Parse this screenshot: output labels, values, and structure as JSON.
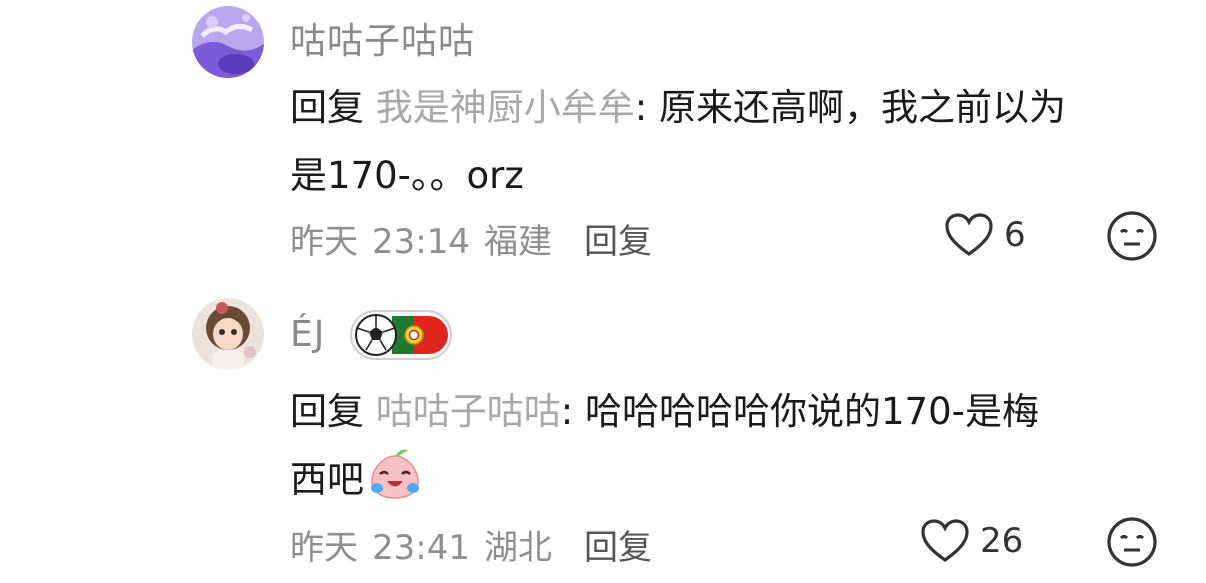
{
  "comments": [
    {
      "username": "咕咕子咕咕",
      "reply_prefix": "回复",
      "reply_target": "我是神厨小牟牟",
      "separator": ": ",
      "text_line1": "原来还高啊，我之前以为",
      "text_line2": "是170-。。orz",
      "date": "昨天",
      "time": "23:14",
      "location": "福建",
      "reply_label": "回复",
      "likes": "6",
      "avatar_icon": "purple-cartoon-avatar",
      "like_icon": "heart-outline-icon",
      "emoji_icon": "neutral-face-icon"
    },
    {
      "username": "ÉJ",
      "badge_icons": [
        "soccer-ball-icon",
        "portugal-flag-icon"
      ],
      "reply_prefix": "回复",
      "reply_target": "咕咕子咕咕",
      "separator": ": ",
      "text_line1": "哈哈哈哈哈你说的170-是梅",
      "text_line2": "西吧",
      "text_emoji": "crying-laughing-peach-emoji",
      "date": "昨天",
      "time": "23:41",
      "location": "湖北",
      "reply_label": "回复",
      "likes": "26",
      "avatar_icon": "doll-photo-avatar",
      "like_icon": "heart-outline-icon",
      "emoji_icon": "neutral-face-icon"
    }
  ],
  "colors": {
    "username": "#8a8a8a",
    "reply_target": "#a8a8a8",
    "meta": "#8f8f8f",
    "portugal_red": "#e0261c",
    "portugal_green": "#1f7a2f"
  }
}
